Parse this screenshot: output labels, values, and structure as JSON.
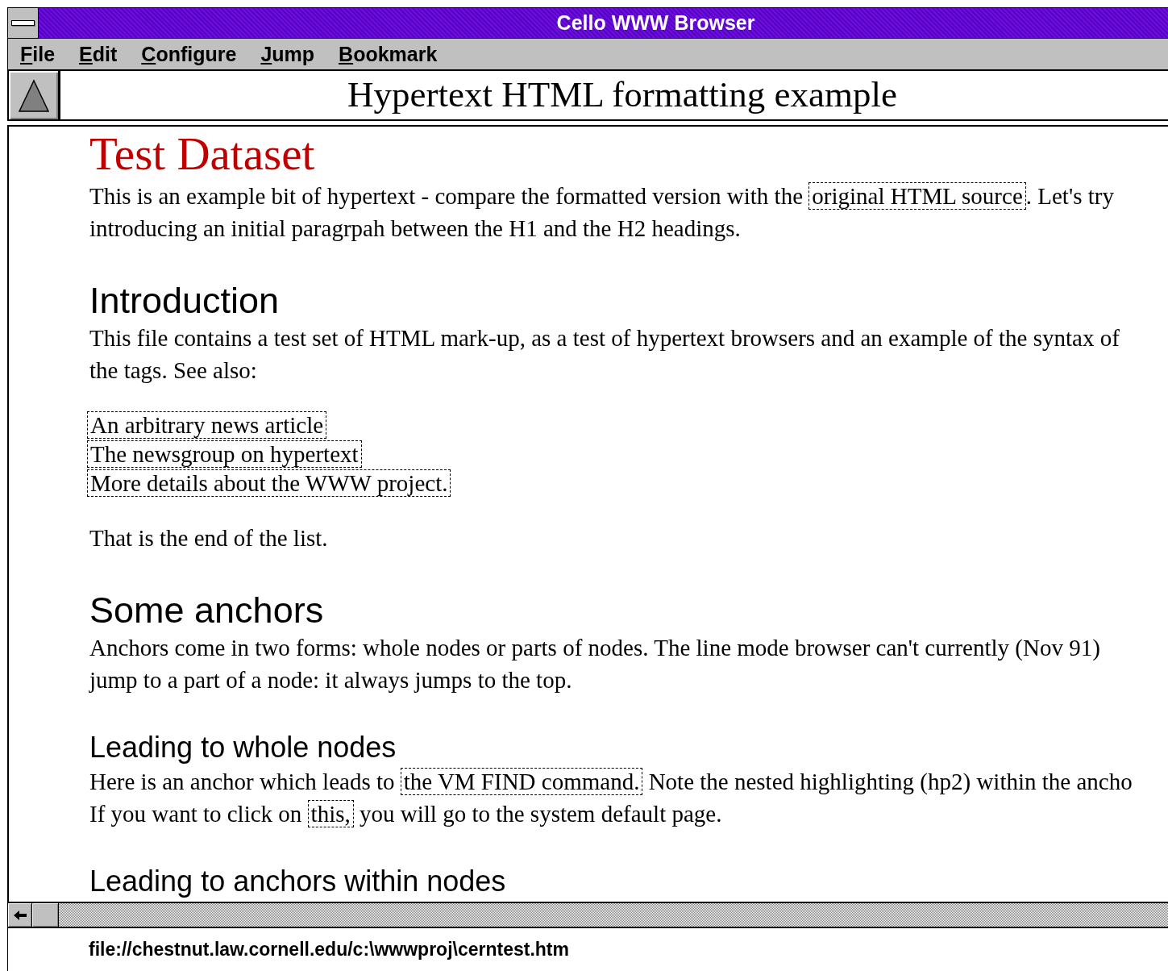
{
  "window": {
    "title": "Cello WWW Browser"
  },
  "menu": [
    {
      "label": "File"
    },
    {
      "label": "Edit"
    },
    {
      "label": "Configure"
    },
    {
      "label": "Jump"
    },
    {
      "label": "Bookmark"
    }
  ],
  "document_title": "Hypertext HTML formatting example",
  "content": [
    {
      "kind": "h1",
      "text": "Test Dataset"
    },
    {
      "kind": "p",
      "lines": [
        [
          {
            "kind": "text",
            "text": "This is an example bit of hypertext - compare  the formatted version with the "
          },
          {
            "kind": "link",
            "text": "original HTML source"
          },
          {
            "kind": "text",
            "text": ". Let's try"
          }
        ],
        [
          {
            "kind": "text",
            "text": "introducing an initial paragrpah between the H1 and the H2 headings."
          }
        ]
      ]
    },
    {
      "kind": "h2",
      "text": "Introduction"
    },
    {
      "kind": "p",
      "lines": [
        [
          {
            "kind": "text",
            "text": "This file contains a test set of HTML mark-up, as a test of hypertext browsers and an example of the syntax of"
          }
        ],
        [
          {
            "kind": "text",
            "text": "the tags. See also:"
          }
        ]
      ]
    },
    {
      "kind": "links",
      "items": [
        "An arbitrary news article",
        "The newsgroup on hypertext",
        "More details about the WWW project."
      ]
    },
    {
      "kind": "p",
      "lines": [
        [
          {
            "kind": "text",
            "text": "That is the end of the list."
          }
        ]
      ]
    },
    {
      "kind": "h2",
      "text": "Some anchors"
    },
    {
      "kind": "p",
      "lines": [
        [
          {
            "kind": "text",
            "text": "Anchors come in two forms: whole nodes or parts of nodes. The line mode browser can't currently (Nov 91)"
          }
        ],
        [
          {
            "kind": "text",
            "text": "jump to a part of a node: it always jumps to the top."
          }
        ]
      ]
    },
    {
      "kind": "h3",
      "text": "Leading to whole nodes"
    },
    {
      "kind": "p",
      "lines": [
        [
          {
            "kind": "text",
            "text": "Here is an anchor which leads to "
          },
          {
            "kind": "link",
            "text": "the VM FIND command."
          },
          {
            "kind": "text",
            "text": " Note the nested highlighting (hp2) within the ancho"
          }
        ],
        [
          {
            "kind": "text",
            "text": "If you want to click on "
          },
          {
            "kind": "link",
            "text": "this,"
          },
          {
            "kind": "text",
            "text": " you will go to the system default page."
          }
        ]
      ]
    },
    {
      "kind": "h3",
      "text": "Leading to anchors within nodes"
    }
  ],
  "status_bar": "file://chestnut.law.cornell.edu/c:\\wwwproj\\cerntest.htm"
}
